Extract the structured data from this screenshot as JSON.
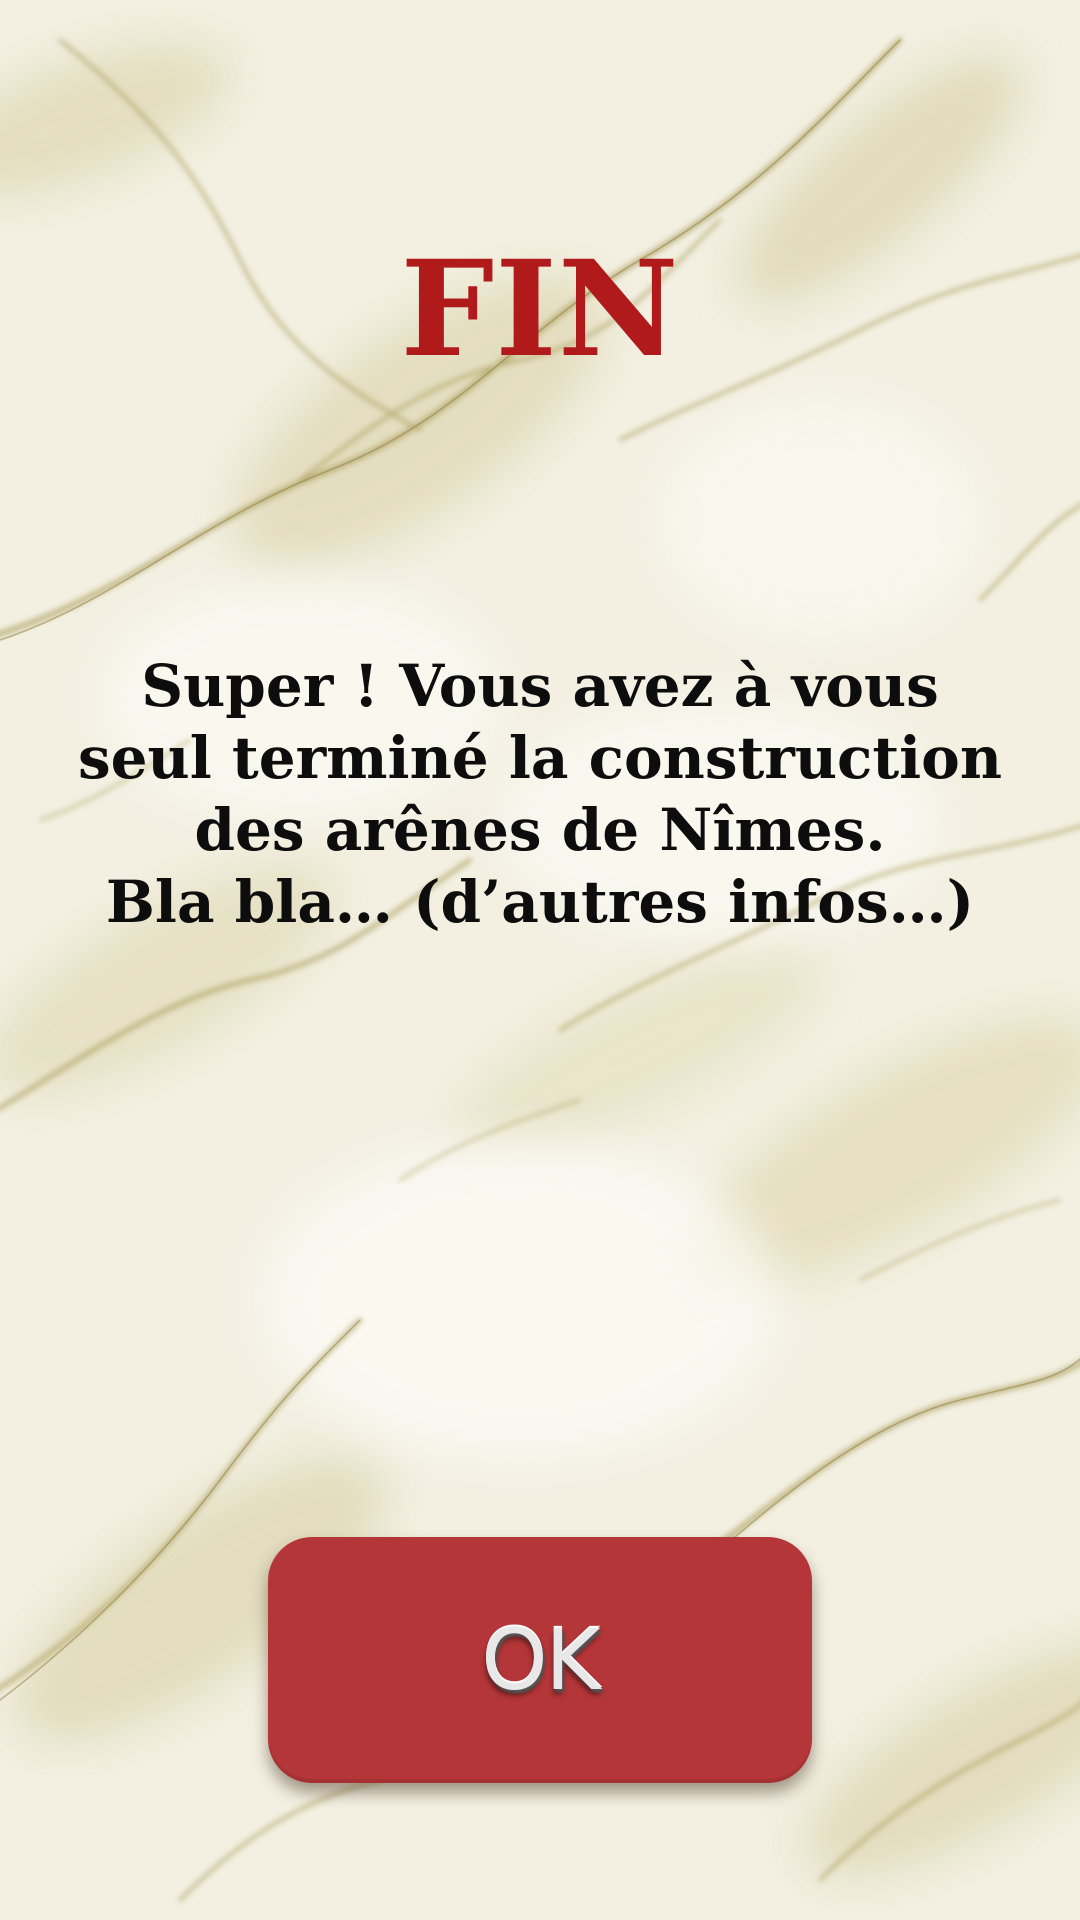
{
  "screen": {
    "title": "FIN",
    "message_lines": [
      "Super ! Vous avez à vous",
      "seul terminé la construction",
      "des arênes de Nîmes.",
      "Bla bla… (d’autres infos…)"
    ],
    "ok_button_label": "OK"
  },
  "colors": {
    "title": "#b01a1a",
    "button": "#b53638",
    "background": "#f4f1e4",
    "veins": "#a89a55"
  }
}
